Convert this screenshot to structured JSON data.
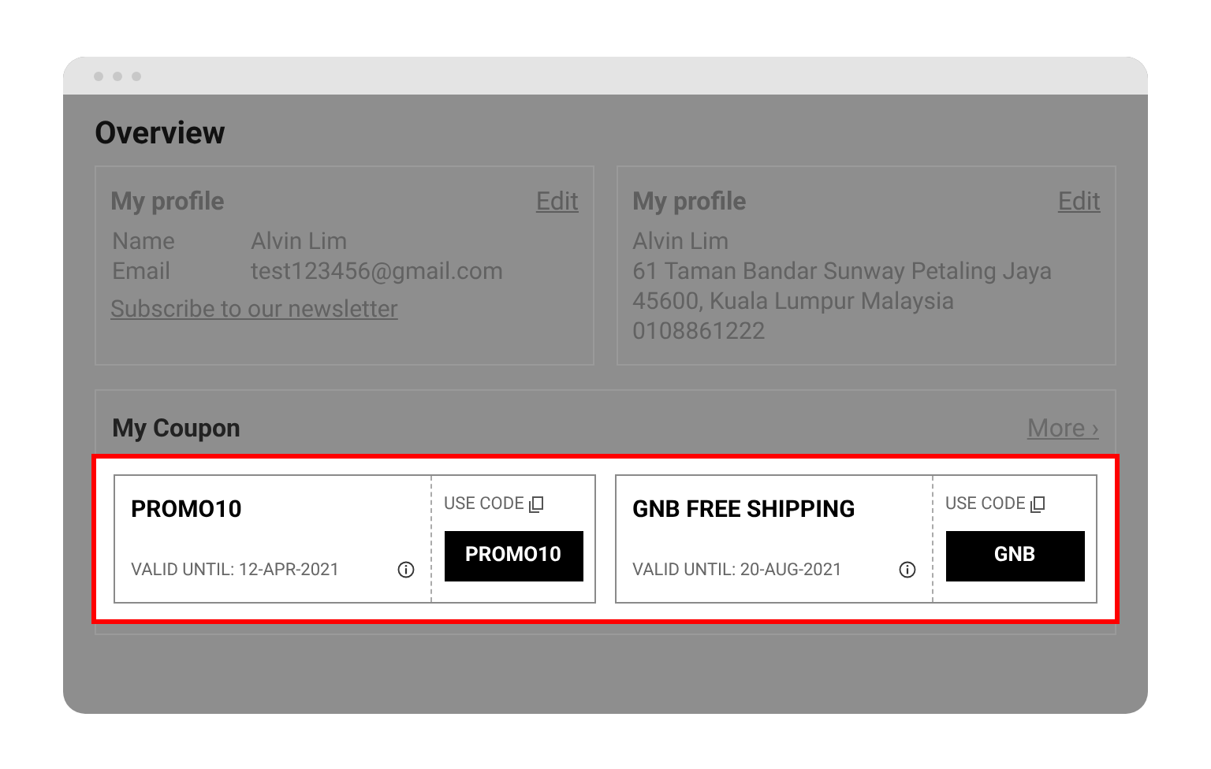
{
  "page_title": "Overview",
  "profile_cards": [
    {
      "title": "My profile",
      "edit": "Edit",
      "kind": "fields",
      "fields": [
        {
          "label": "Name",
          "value": "Alvin Lim"
        },
        {
          "label": "Email",
          "value": "test123456@gmail.com"
        }
      ],
      "link": "Subscribe to our newsletter"
    },
    {
      "title": "My profile",
      "edit": "Edit",
      "kind": "address",
      "lines": [
        "Alvin Lim",
        "61 Taman Bandar Sunway Petaling Jaya",
        "45600, Kuala Lumpur Malaysia",
        "0108861222"
      ]
    }
  ],
  "coupons_section": {
    "title": "My Coupon",
    "more": "More ›",
    "coupons": [
      {
        "name": "PROMO10",
        "valid": "VALID UNTIL: 12-APR-2021",
        "use_code": "USE CODE",
        "code": "PROMO10"
      },
      {
        "name": "GNB FREE SHIPPING",
        "valid": "VALID UNTIL: 20-AUG-2021",
        "use_code": "USE CODE",
        "code": "GNB"
      }
    ]
  }
}
